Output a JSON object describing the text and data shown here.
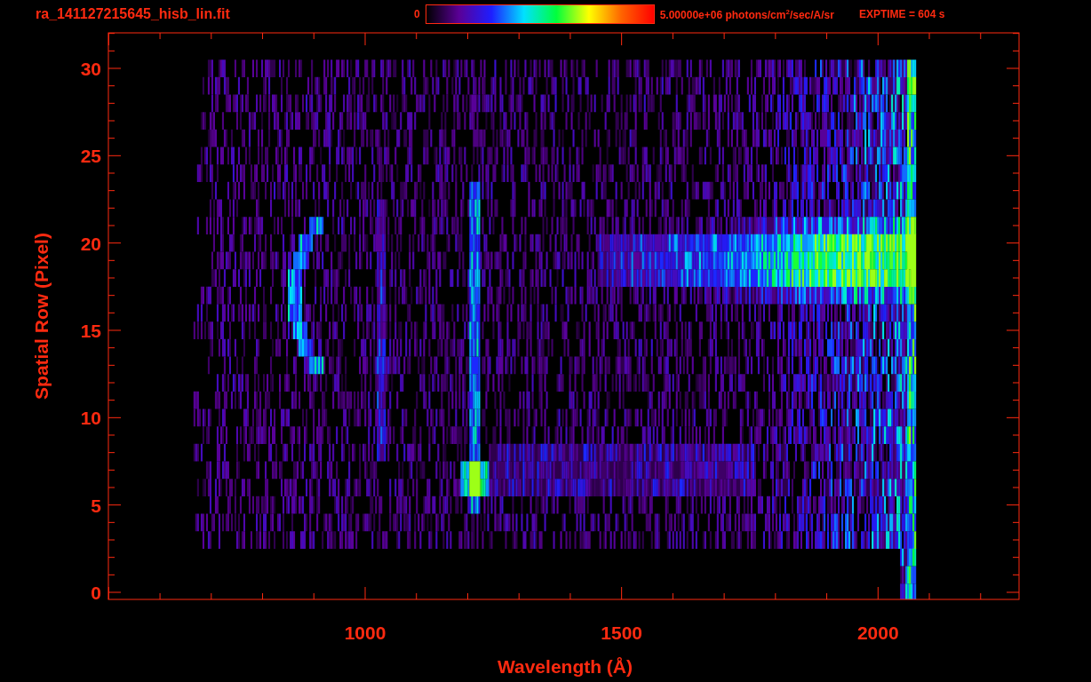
{
  "title": "ra_141127215645_hisb_lin.fit",
  "colorbar": {
    "min_label": "0",
    "max_label": "5.00000e+06 photons/cm$^{2}$/sec/A/sr"
  },
  "exposure": "EXPTIME = 604 s",
  "plot": {
    "xlabel": "Wavelength (Å)",
    "ylabel": "Spatial Row (Pixel)",
    "xtick_labels": [
      "1000",
      "1500",
      "2000"
    ],
    "ytick_labels": [
      "30",
      "25",
      "20",
      "15",
      "10",
      "5",
      "0"
    ]
  }
}
